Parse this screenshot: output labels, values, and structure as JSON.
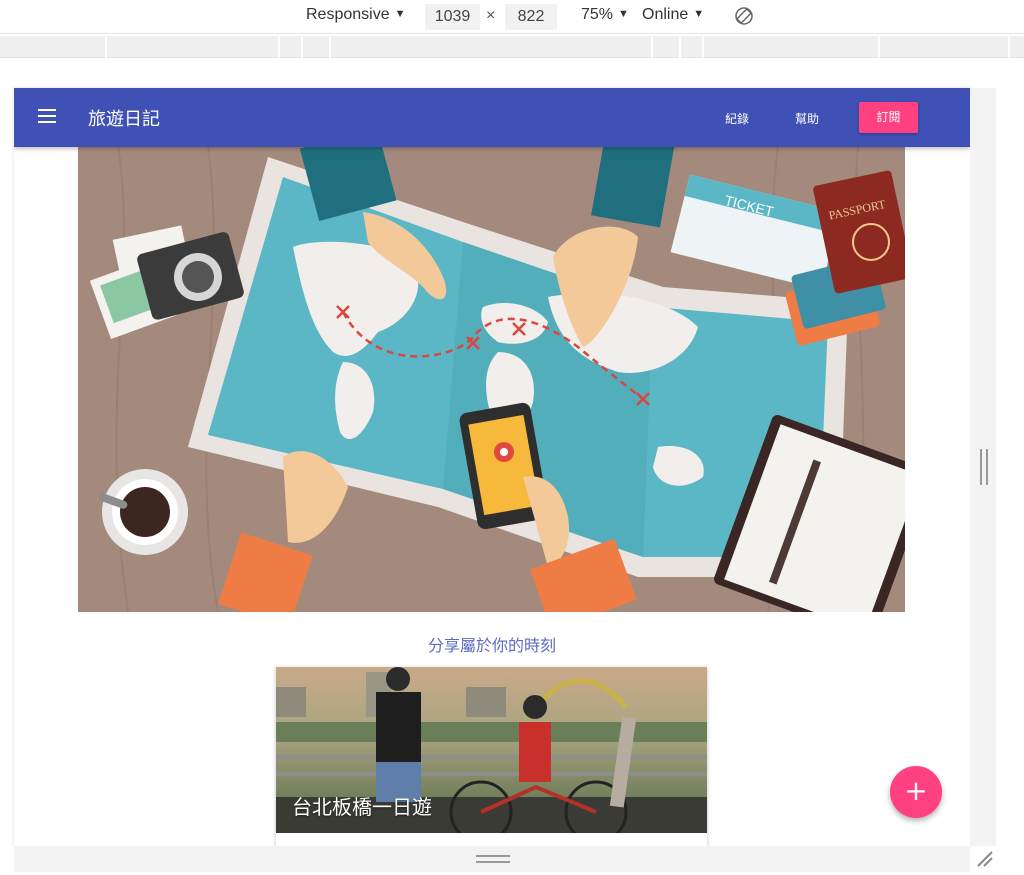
{
  "devtools": {
    "device": "Responsive",
    "width": "1039",
    "height": "822",
    "times": "×",
    "zoom": "75%",
    "network": "Online"
  },
  "app": {
    "title": "旅遊日記",
    "nav": [
      "紀錄",
      "幫助"
    ],
    "subscribe_label": "訂閱",
    "tagline": "分享屬於你的時刻",
    "card_title": "台北板橋一日遊",
    "fab_label": "+",
    "accent": "#ff4081",
    "primary": "#3f51b5"
  },
  "hero": {
    "ticket_text": "TICKET",
    "passport_text": "PASSPORT"
  }
}
